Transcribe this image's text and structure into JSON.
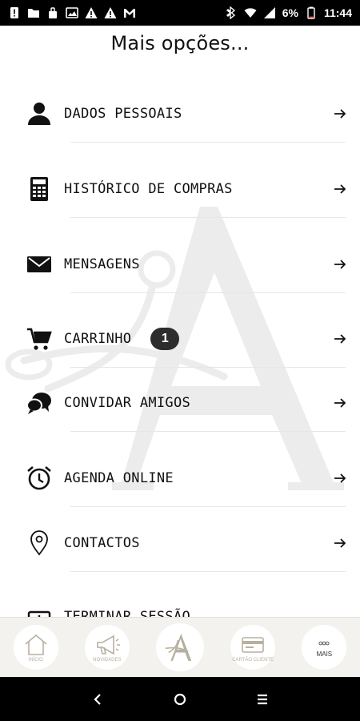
{
  "status_bar": {
    "battery_percent": "6%",
    "time": "11:44"
  },
  "page": {
    "title": "Mais opções..."
  },
  "menu": {
    "items": [
      {
        "label": "DADOS PESSOAIS",
        "icon": "person-icon"
      },
      {
        "label": "HISTÓRICO DE COMPRAS",
        "icon": "calculator-icon"
      },
      {
        "label": "MENSAGENS",
        "icon": "envelope-icon"
      },
      {
        "label": "CARRINHO",
        "icon": "cart-icon",
        "badge": "1"
      },
      {
        "label": "CONVIDAR AMIGOS",
        "icon": "chat-bubbles-icon"
      },
      {
        "label": "AGENDA ONLINE",
        "icon": "alarm-clock-icon"
      },
      {
        "label": "CONTACTOS",
        "icon": "location-pin-icon"
      },
      {
        "label": "TERMINAR SESSÃO",
        "icon": "logout-icon"
      }
    ]
  },
  "tab_bar": {
    "tabs": [
      {
        "label": "INÍCIO",
        "icon": "home-icon"
      },
      {
        "label": "NOVIDADES",
        "icon": "megaphone-icon"
      },
      {
        "label": "",
        "icon": "brand-logo-icon"
      },
      {
        "label": "CARTÃO CLIENTE",
        "icon": "card-icon"
      },
      {
        "label": "MAIS",
        "icon": "more-icon"
      }
    ]
  },
  "colors": {
    "text": "#111111",
    "badge_bg": "#2d2d2d",
    "tab_bar_bg": "#f3f2ee",
    "tab_label": "#b7b0a0",
    "watermark": "#ececec"
  }
}
